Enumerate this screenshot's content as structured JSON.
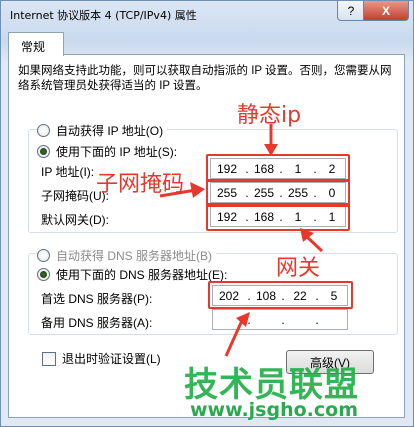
{
  "window": {
    "title": "Internet 协议版本 4 (TCP/IPv4) 属性",
    "help_label": "?",
    "close_label": "X"
  },
  "tabs": [
    {
      "label": "常规"
    }
  ],
  "description": "如果网络支持此功能，则可以获取自动指派的 IP 设置。否则，您需要从网络系统管理员处获得适当的 IP 设置。",
  "ip_section": {
    "auto_label": "自动获得 IP 地址(O)",
    "manual_label": "使用下面的 IP 地址(S):",
    "selected": "manual",
    "fields": [
      {
        "label": "IP 地址(I):",
        "octets": [
          "192",
          "168",
          "1",
          "2"
        ]
      },
      {
        "label": "子网掩码(U):",
        "octets": [
          "255",
          "255",
          "255",
          "0"
        ]
      },
      {
        "label": "默认网关(D):",
        "octets": [
          "192",
          "168",
          "1",
          "1"
        ]
      }
    ]
  },
  "dns_section": {
    "auto_label": "自动获得 DNS 服务器地址(B)",
    "manual_label": "使用下面的 DNS 服务器地址(E):",
    "selected": "manual",
    "fields": [
      {
        "label": "首选 DNS 服务器(P):",
        "octets": [
          "202",
          "108",
          "22",
          "5"
        ]
      },
      {
        "label": "备用 DNS 服务器(A):",
        "octets": [
          "",
          "",
          "",
          ""
        ]
      }
    ]
  },
  "validate_checkbox": {
    "label": "退出时验证设置(L)",
    "checked": false
  },
  "advanced_button": {
    "label": "高级(V)"
  },
  "annotations": {
    "static_ip": "静态ip",
    "subnet_mask": "子网掩码",
    "gateway": "网关",
    "color": "#e8382e"
  },
  "watermark": {
    "text": "技术员联盟",
    "url": "www.jsgho.com",
    "color": "#23b04a"
  }
}
